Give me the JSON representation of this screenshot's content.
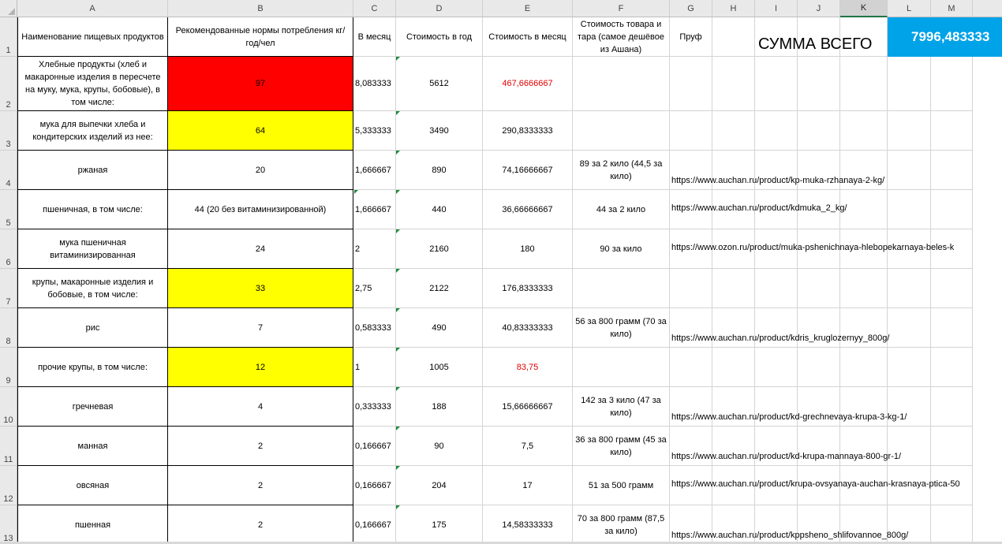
{
  "columns": [
    "A",
    "B",
    "C",
    "D",
    "E",
    "F",
    "G",
    "H",
    "I",
    "J",
    "K",
    "L",
    "M"
  ],
  "selected_column": "K",
  "headers": {
    "A": "Наименование пищевых продуктов",
    "B": "Рекомендованные нормы потребления кг/год/чел",
    "C": "В месяц",
    "D": "Стоимость в год",
    "E": "Стоимость в месяц",
    "F": "Стоимость товара и тара (самое дешёвое из Ашана)",
    "G": "Пруф"
  },
  "total": {
    "label": "СУММА ВСЕГО",
    "value": "7996,483333"
  },
  "colors": {
    "red_fill": "#ff0000",
    "yellow_fill": "#ffff00",
    "total_fill": "#00a2e8",
    "red_text": "#e00000"
  },
  "rows": [
    {
      "num": "2",
      "name": "Хлебные продукты (хлеб и макаронные изделия в пересчете на муку, мука, крупы, бобовые), в том числе:",
      "norm": "97",
      "norm_fill": "red",
      "month": "8,083333",
      "year_cost": "5612",
      "month_cost": "467,6666667",
      "month_cost_red": true,
      "price": "",
      "url": ""
    },
    {
      "num": "3",
      "name": "мука для выпечки хлеба и кондитерских изделий из нее:",
      "norm": "64",
      "norm_fill": "yellow",
      "month": "5,333333",
      "year_cost": "3490",
      "month_cost": "290,8333333",
      "month_cost_red": false,
      "price": "",
      "url": ""
    },
    {
      "num": "4",
      "name": "ржаная",
      "norm": "20",
      "norm_fill": "",
      "month": "1,666667",
      "year_cost": "890",
      "month_cost": "74,16666667",
      "month_cost_red": false,
      "price": "89 за 2 кило (44,5 за кило)",
      "url": "https://www.auchan.ru/product/kp-muka-rzhanaya-2-kg/"
    },
    {
      "num": "5",
      "name": "пшеничная, в том числе:",
      "norm": "44 (20 без витаминизированной)",
      "norm_fill": "",
      "month": "1,666667",
      "year_cost": "440",
      "month_cost": "36,66666667",
      "month_cost_red": false,
      "price": "44 за 2 кило",
      "url": "https://www.auchan.ru/product/kdmuka_2_kg/"
    },
    {
      "num": "6",
      "name": "мука пшеничная витаминизированная",
      "norm": "24",
      "norm_fill": "",
      "month": "2",
      "year_cost": "2160",
      "month_cost": "180",
      "month_cost_red": false,
      "price": "90 за кило",
      "url": "https://www.ozon.ru/product/muka-pshenichnaya-hlebopekarnaya-beles-k"
    },
    {
      "num": "7",
      "name": "крупы, макаронные изделия и бобовые, в том числе:",
      "norm": "33",
      "norm_fill": "yellow",
      "month": "2,75",
      "year_cost": "2122",
      "month_cost": "176,8333333",
      "month_cost_red": false,
      "price": "",
      "url": ""
    },
    {
      "num": "8",
      "name": "рис",
      "norm": "7",
      "norm_fill": "",
      "month": "0,583333",
      "year_cost": "490",
      "month_cost": "40,83333333",
      "month_cost_red": false,
      "price": "56 за 800 грамм (70 за кило)",
      "url": "https://www.auchan.ru/product/kdris_kruglozernyy_800g/"
    },
    {
      "num": "9",
      "name": "прочие крупы, в том числе:",
      "norm": "12",
      "norm_fill": "yellow",
      "month": "1",
      "year_cost": "1005",
      "month_cost": "83,75",
      "month_cost_red": true,
      "price": "",
      "url": ""
    },
    {
      "num": "10",
      "name": "гречневая",
      "norm": "4",
      "norm_fill": "",
      "month": "0,333333",
      "year_cost": "188",
      "month_cost": "15,66666667",
      "month_cost_red": false,
      "price": "142 за 3 кило (47 за кило)",
      "url": "https://www.auchan.ru/product/kd-grechnevaya-krupa-3-kg-1/"
    },
    {
      "num": "11",
      "name": "манная",
      "norm": "2",
      "norm_fill": "",
      "month": "0,166667",
      "year_cost": "90",
      "month_cost": "7,5",
      "month_cost_red": false,
      "price": "36 за 800 грамм (45 за кило)",
      "url": "https://www.auchan.ru/product/kd-krupa-mannaya-800-gr-1/"
    },
    {
      "num": "12",
      "name": "овсяная",
      "norm": "2",
      "norm_fill": "",
      "month": "0,166667",
      "year_cost": "204",
      "month_cost": "17",
      "month_cost_red": false,
      "price": "51 за 500 грамм",
      "url": "https://www.auchan.ru/product/krupa-ovsyanaya-auchan-krasnaya-ptica-50"
    },
    {
      "num": "13",
      "name": "пшенная",
      "norm": "2",
      "norm_fill": "",
      "month": "0,166667",
      "year_cost": "175",
      "month_cost": "14,58333333",
      "month_cost_red": false,
      "price": "70 за 800 грамм (87,5 за кило)",
      "url": "https://www.auchan.ru/product/kppsheno_shlifovannoe_800g/"
    }
  ]
}
